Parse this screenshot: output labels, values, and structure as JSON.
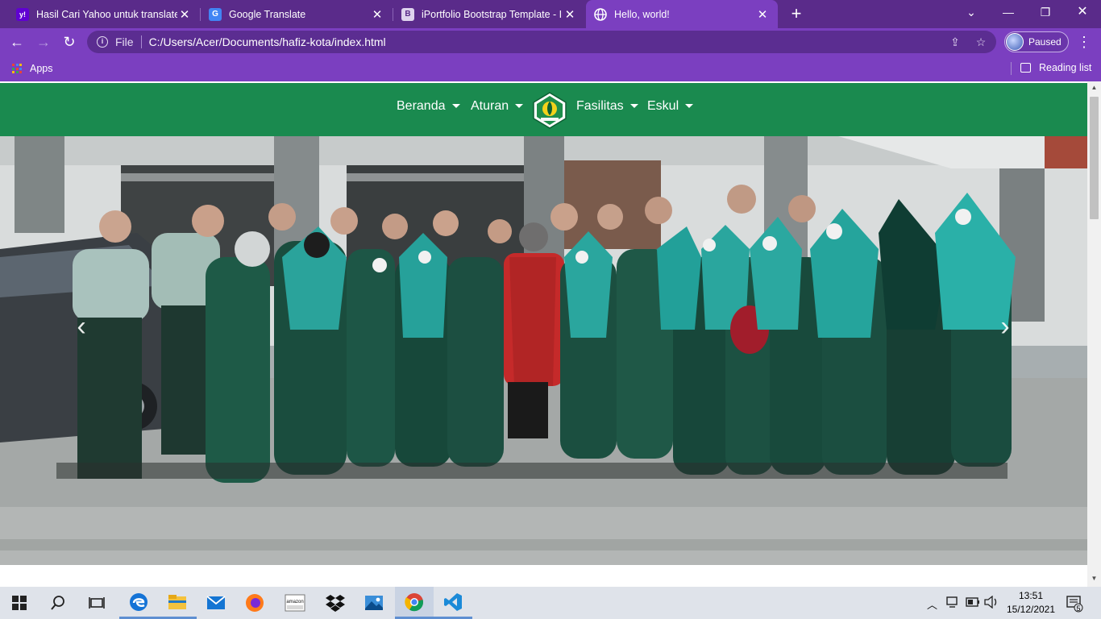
{
  "browser": {
    "tabs": [
      {
        "title": "Hasil Cari Yahoo untuk translate",
        "favicon": "yahoo-icon",
        "favicon_letter": "y!",
        "active": false
      },
      {
        "title": "Google Translate",
        "favicon": "google-translate-icon",
        "favicon_letter": "G",
        "active": false
      },
      {
        "title": "iPortfolio Bootstrap Template - In",
        "favicon": "bootstrap-icon",
        "favicon_letter": "B",
        "active": false
      },
      {
        "title": "Hello, world!",
        "favicon": "globe-icon",
        "favicon_letter": "",
        "active": true
      }
    ],
    "address": {
      "scheme_label": "File",
      "url": "C:/Users/Acer/Documents/hafiz-kota/index.html"
    },
    "profile_label": "Paused",
    "bookmarks": {
      "apps_label": "Apps",
      "reading_list_label": "Reading list"
    },
    "colors": {
      "frame": "#5a2b8a",
      "toolbar": "#7b3fc0"
    }
  },
  "site": {
    "nav": {
      "items": [
        {
          "label": "Beranda"
        },
        {
          "label": "Aturan"
        },
        {
          "label": "Fasilitas"
        },
        {
          "label": "Eskul"
        }
      ],
      "logo": "school-emblem-icon",
      "color": "#1a8a4f"
    },
    "hero": {
      "image": "group-photo-students-in-green-uniforms",
      "prev_control": "carousel-prev-icon",
      "next_control": "carousel-next-icon"
    }
  },
  "taskbar": {
    "apps": [
      "start-icon",
      "search-icon",
      "task-view-icon",
      "edge-icon",
      "file-explorer-icon",
      "mail-icon",
      "firefox-icon",
      "amazon-icon",
      "dropbox-icon",
      "photos-icon",
      "chrome-icon",
      "vscode-icon"
    ],
    "clock": {
      "time": "13:51",
      "date": "15/12/2021"
    },
    "notifications_count": "5"
  }
}
